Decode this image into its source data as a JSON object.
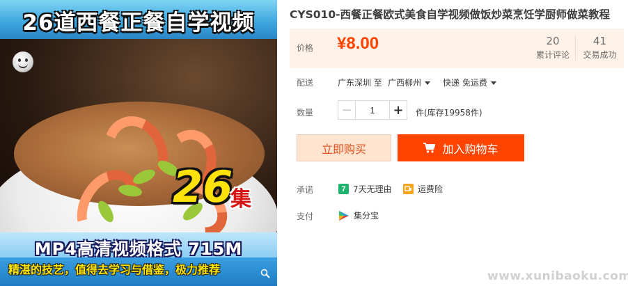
{
  "image": {
    "top_banner": "26道西餐正餐自学视频",
    "episode_count": "26",
    "episode_unit": "集",
    "format_line": "MP4高清视频格式  715M",
    "slogan": "精湛的技艺，值得去学习与借鉴，极力推荐"
  },
  "product": {
    "title": "CYS010-西餐正餐欧式美食自学视频做饭炒菜烹饪学厨师做菜教程"
  },
  "price": {
    "label": "价格",
    "value": "¥8.00",
    "reviews_count": "20",
    "reviews_label": "累计评论",
    "sales_count": "41",
    "sales_label": "交易成功"
  },
  "delivery": {
    "label": "配送",
    "route": "广东深圳 至",
    "destination": "广西柳州",
    "shipping": "快递 免运费"
  },
  "quantity": {
    "label": "数量",
    "value": "1",
    "unit": "件(库存19958件)",
    "minus": "−",
    "plus": "+"
  },
  "actions": {
    "buy_now": "立即购买",
    "add_to_cart": "加入购物车"
  },
  "promise": {
    "label": "承诺",
    "return_icon_text": "7",
    "return_text": "7天无理由",
    "freight_text": "运费险"
  },
  "payment": {
    "label": "支付",
    "method": "集分宝"
  },
  "watermark": "www.xunibaoku.com",
  "colors": {
    "accent": "#ff4400",
    "price_panel_bg": "#fff2e8",
    "buy_now_bg": "#ffe4d0"
  }
}
